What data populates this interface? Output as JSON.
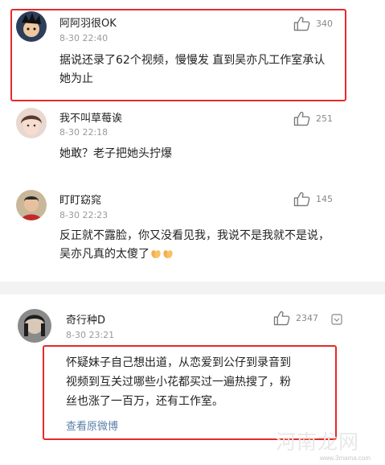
{
  "comments": [
    {
      "username": "阿阿羽很OK",
      "time": "8-30 22:40",
      "likes": "340",
      "text_lines": [
        "据说还录了62个视频，慢慢发 直到吴亦凡工作室承认",
        "她为止"
      ]
    },
    {
      "username": "我不叫草莓诶",
      "time": "8-30 22:18",
      "likes": "251",
      "text_lines": [
        "她敢？老子把她头拧爆"
      ]
    },
    {
      "username": "盯盯窈窕",
      "time": "8-30 22:23",
      "likes": "145",
      "text_lines": [
        "反正就不露脸，你又没看见我，我说不是我就不是说，",
        "吴亦凡真的太傻了"
      ]
    },
    {
      "username": "奇行种D",
      "time": "8-30 23:21",
      "likes": "2347",
      "text_lines": [
        "怀疑妹子自己想出道，从恋爱到公仔到录音到",
        "视频到互关过哪些小花都买过一遍热搜了，粉",
        "丝也涨了一百万，还有工作室。"
      ],
      "link": "查看原微博"
    }
  ],
  "watermark": {
    "main": "河南龙网",
    "sub": "www.3mama.com"
  },
  "colors": {
    "highlight_border": "#e52a2a",
    "link": "#5a7fa8",
    "meta_text": "#999999"
  },
  "icons": [
    "thumbs-up-icon",
    "more-icon",
    "clap-emoji-icon"
  ]
}
